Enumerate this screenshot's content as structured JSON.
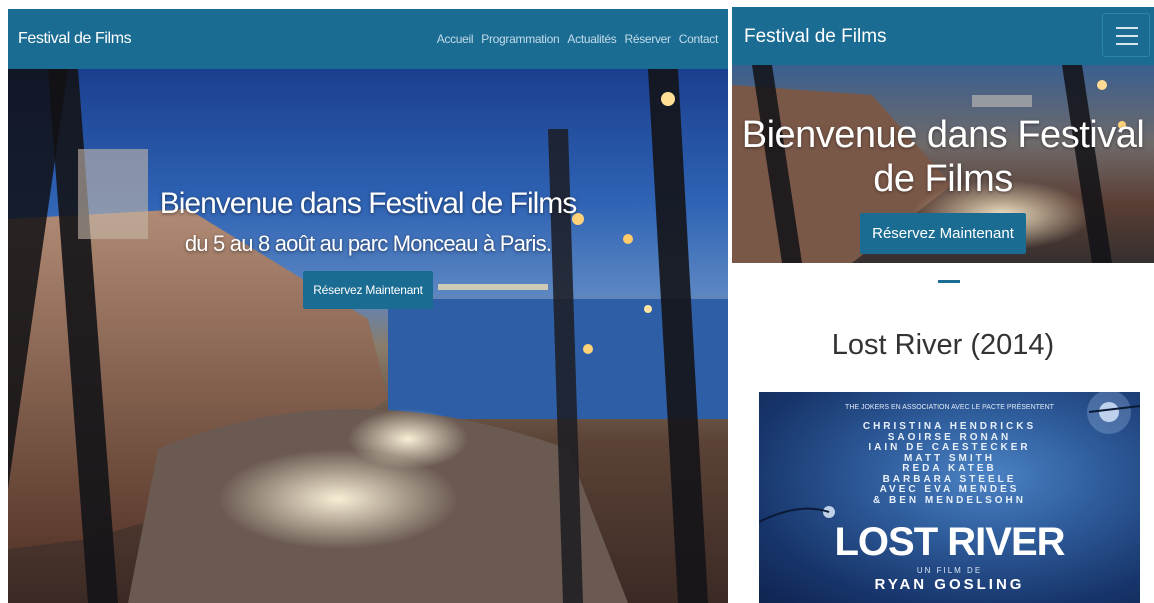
{
  "desktop": {
    "brand": "Festival de Films",
    "menu": [
      "Accueil",
      "Programmation",
      "Actualités",
      "Réserver",
      "Contact"
    ],
    "hero": {
      "title": "Bienvenue dans Festival de Films",
      "subtitle": "du 5 au 8 août au parc Monceau à Paris.",
      "cta": "Réservez Maintenant"
    }
  },
  "mobile": {
    "brand": "Festival de Films",
    "toggle_icon": "hamburger-menu-icon",
    "hero": {
      "title": "Bienvenue dans Festival de Films",
      "cta": "Réservez Maintenant"
    },
    "movie_title": "Lost River (2014)",
    "poster": {
      "presenters": "THE JOKERS EN ASSOCIATION AVEC LE PACTE PRÉSENTENT",
      "cast": [
        "CHRISTINA HENDRICKS",
        "SAOIRSE RONAN",
        "IAIN DE CAESTECKER",
        "MATT SMITH",
        "REDA KATEB",
        "BARBARA STEELE",
        "AVEC EVA MENDES",
        "& BEN MENDELSOHN"
      ],
      "title": "LOST RIVER",
      "film_by": "UN FILM DE",
      "director": "RYAN GOSLING"
    }
  },
  "colors": {
    "nav": "#1a6c93",
    "button": "#1a6c93"
  }
}
